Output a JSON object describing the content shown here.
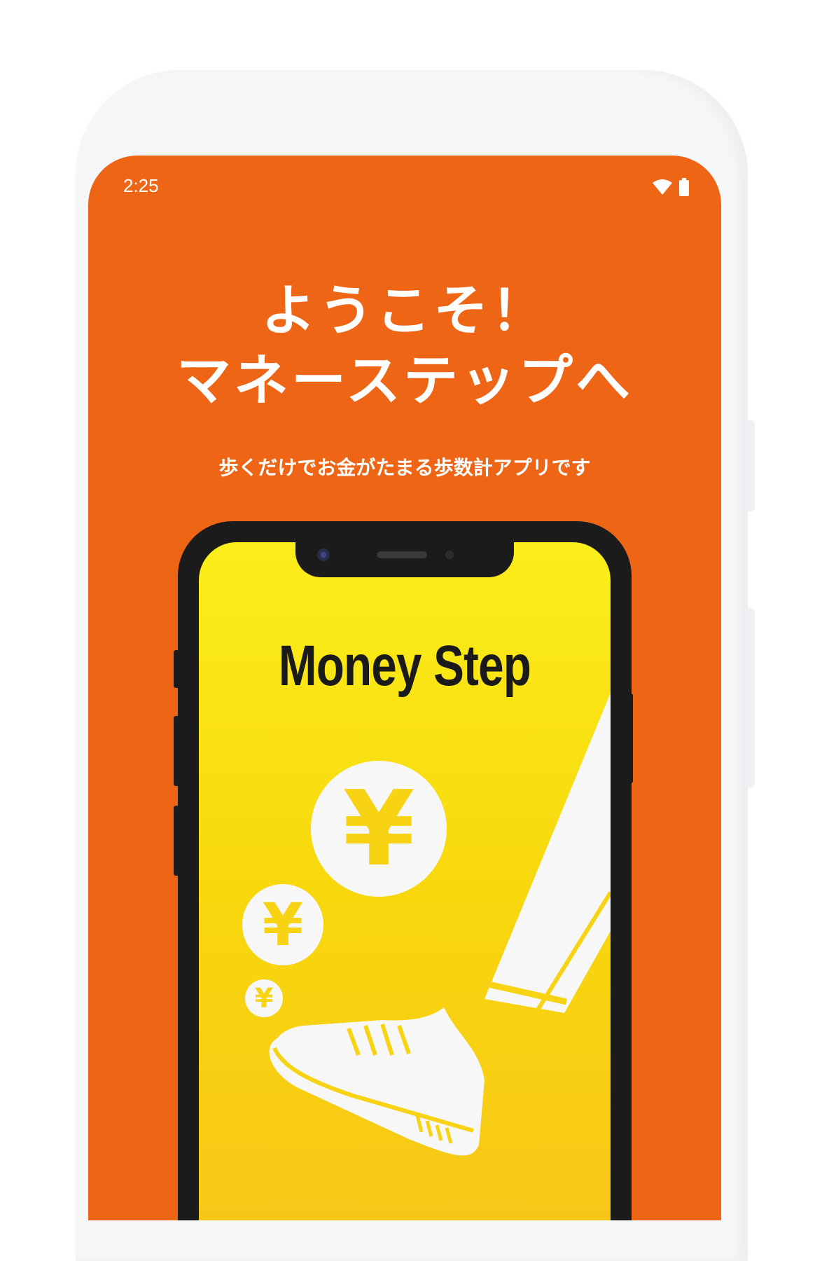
{
  "status_bar": {
    "time": "2:25",
    "wifi_icon": "wifi-icon",
    "battery_icon": "battery-icon"
  },
  "hero": {
    "line1": "ようこそ！",
    "line2": "マネーステップへ",
    "subtitle": "歩くだけでお金がたまる歩数計アプリです"
  },
  "mockup": {
    "app_title": "Money Step",
    "coin_symbol": "¥",
    "illustration": "walking-leg-with-yen-coins"
  },
  "colors": {
    "background_orange": "#ee6516",
    "screen_yellow": "#fbee1a",
    "white": "#ffffff"
  }
}
